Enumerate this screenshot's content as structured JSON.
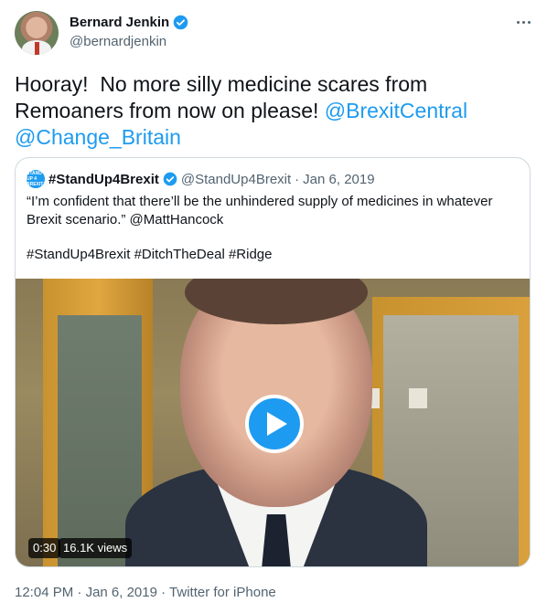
{
  "author": {
    "name": "Bernard Jenkin",
    "handle": "@bernardjenkin",
    "verified_icon": "verified-badge-icon"
  },
  "tweet": {
    "text_main": "Hooray!  No more silly medicine scares from Remoaners from now on please! ",
    "mention_1": "@BrexitCentral",
    "mention_2": "@Change_Britain"
  },
  "quoted": {
    "avatar_label": "STAND UP 4 BREXIT",
    "name": "#StandUp4Brexit",
    "handle": "@StandUp4Brexit",
    "separator": "·",
    "date": "Jan 6, 2019",
    "text": "“I’m confident that there’ll be the unhindered supply of medicines in whatever Brexit scenario.” @MattHancock",
    "hashtags": "#StandUp4Brexit #DitchTheDeal #Ridge",
    "video": {
      "duration": "0:30",
      "views": "16.1K views"
    }
  },
  "footer": {
    "time": "12:04 PM",
    "separator_1": "·",
    "date": "Jan 6, 2019",
    "separator_2": "·",
    "source": "Twitter for iPhone"
  },
  "colors": {
    "accent": "#1d9bf0",
    "text": "#0f1419",
    "secondary": "#536471",
    "border": "#cfd9de"
  }
}
